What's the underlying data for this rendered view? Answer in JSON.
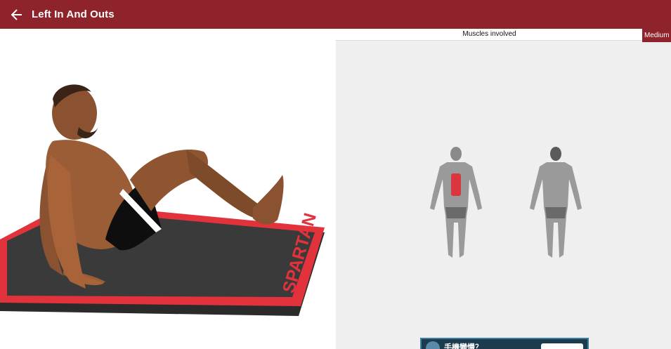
{
  "header": {
    "title": "Left In And Outs",
    "back_icon": "arrow-left-icon"
  },
  "panel": {
    "muscles_label": "Muscles involved",
    "difficulty": "Medium",
    "figures": [
      "front-muscle-figure",
      "back-muscle-figure"
    ]
  },
  "exercise_image": {
    "mat_text": "SPARTAN"
  },
  "ad": {
    "text": "手機變慢？"
  },
  "colors": {
    "brand": "#8e232b",
    "mat_red": "#e2323c",
    "mat_dark": "#3a3a3a",
    "highlight": "#d9363e"
  }
}
